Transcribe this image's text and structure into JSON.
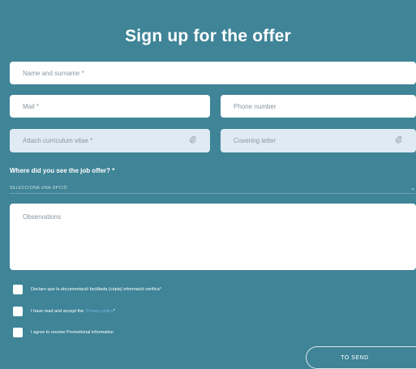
{
  "form": {
    "title": "Sign up for the offer",
    "name_placeholder": "Name and surname *",
    "mail_placeholder": "Mail *",
    "phone_placeholder": "Phone number",
    "cv_placeholder": "Attach curriculum vitae *",
    "cover_placeholder": "Covering letter",
    "source_question": "Where did you see the job offer? *",
    "source_select_value": "SELECCIONA UNA OPCIÓ",
    "observations_placeholder": "Observations",
    "checkbox_certify": "Declaro que la documentació facilitada (còpia) informació verifica*",
    "checkbox_privacy_prefix": "I have read and accept the",
    "checkbox_privacy_link": "Privacy policy",
    "checkbox_privacy_suffix": " *",
    "checkbox_promo": "I agree to receive Promotional information",
    "send_label": "TO SEND"
  },
  "icons": {
    "paperclip": "paperclip-icon",
    "chevron": "chevron-down-icon"
  },
  "colors": {
    "background": "#3f8497",
    "input_background": "#ffffff",
    "attach_background": "#dfeaf2",
    "link": "#79b6e0"
  }
}
